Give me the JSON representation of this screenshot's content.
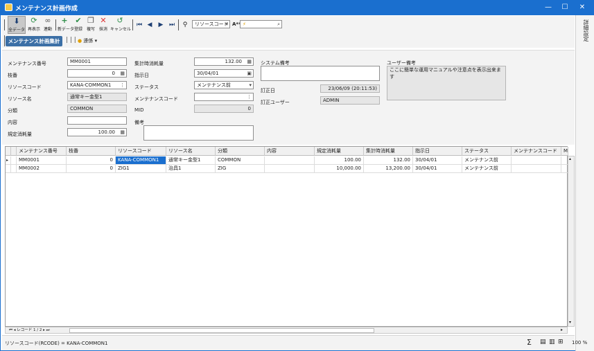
{
  "window": {
    "title": "メンテナンス計画作成",
    "minimize": "—",
    "maximize": "☐",
    "close": "✕"
  },
  "right_panel": {
    "label": "詳細設定"
  },
  "toolbar": {
    "all_data": "全データ",
    "redisplay": "再表示",
    "link": "連動",
    "new_data": "新データ",
    "register": "登録",
    "copy": "複写",
    "delete": "抹消",
    "cancel": "キャンセル",
    "search_field": "リソースコード",
    "font_label": "A**"
  },
  "toolbar2": {
    "tab_label": "メンテナンス計画集計",
    "options_label": "連係"
  },
  "form": {
    "maint_no_label": "メンテナンス番号",
    "maint_no": "MM0001",
    "branch_label": "枝番",
    "branch": "0",
    "rcode_label": "リソースコード",
    "rcode": "KANA-COMMON1",
    "rname_label": "リソース名",
    "rname": "通常キー金型1",
    "class_label": "分類",
    "class": "COMMON",
    "content_label": "内容",
    "content": "",
    "std_label": "規定消耗量",
    "std": "100.00",
    "plan_label": "集計時消耗量",
    "plan": "132.00",
    "date_label": "指示日",
    "date": "30/04/01",
    "status_label": "ステータス",
    "status": "メンテナンス前",
    "mcode_label": "メンテナンスコード",
    "mcode": "",
    "mid_label": "MID",
    "mid": "0",
    "remarks_label": "備考",
    "remarks": "",
    "sysrem_label": "システム備考",
    "sysrem": "",
    "updated_label": "訂正日",
    "updated": "23/06/09 (20:11:53)",
    "upduser_label": "訂正ユーザー",
    "upduser": "ADMIN",
    "userrem_label": "ユーザー備考",
    "userrem": "ここに簡単な運用マニュアルや注意点を表示出来ます"
  },
  "grid": {
    "columns": [
      "メンテナンス番号",
      "枝番",
      "リソースコード",
      "リソース名",
      "分類",
      "内容",
      "規定消耗量",
      "集計時消耗量",
      "指示日",
      "ステータス",
      "メンテナンスコード",
      "M"
    ],
    "rows": [
      [
        "MM0001",
        "0",
        "KANA-COMMON1",
        "通常キー金型1",
        "COMMON",
        "",
        "100.00",
        "132.00",
        "30/04/01",
        "メンテナンス前",
        "",
        ""
      ],
      [
        "MM0002",
        "0",
        "ZIG1",
        "治具1",
        "ZIG",
        "",
        "10,000.00",
        "13,200.00",
        "30/04/01",
        "メンテナンス前",
        "",
        ""
      ]
    ]
  },
  "navigator": {
    "text": "レコード 1 / 2"
  },
  "status": {
    "text": "リソースコード(RCODE) = KANA-COMMON1",
    "zoom": "100",
    "percent": "%"
  }
}
